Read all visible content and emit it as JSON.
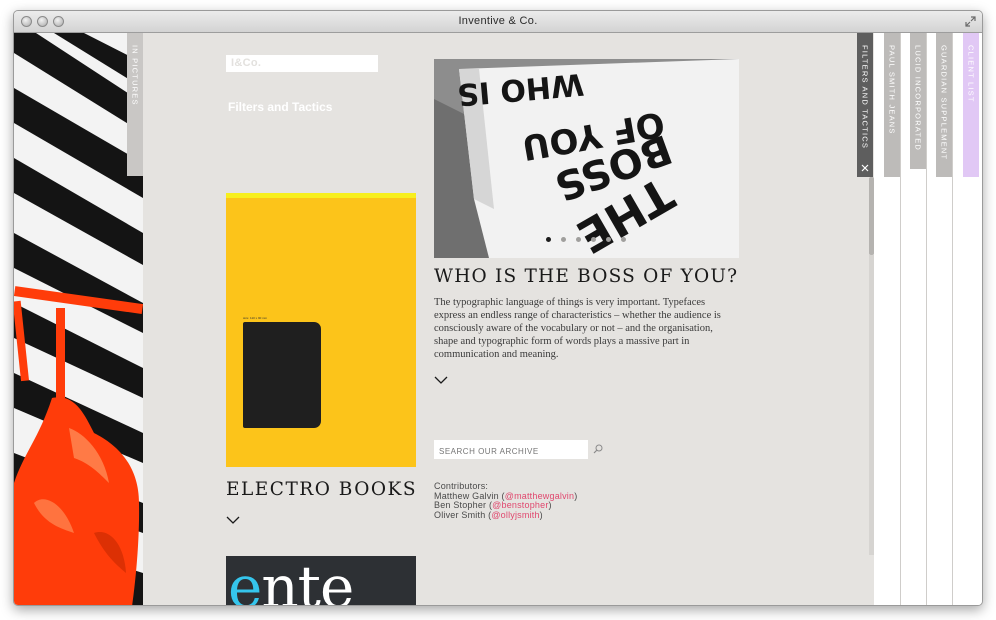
{
  "window": {
    "title": "Inventive & Co."
  },
  "left_tab": {
    "label": "IN PICTURES"
  },
  "header": {
    "logo": "I&Co.",
    "section": "Filters and Tactics"
  },
  "book": {
    "label": "size: 110 x 90 mm",
    "title": "ELECTRO BOOKS"
  },
  "teaser": {
    "text_a": "e",
    "text_b": "nte"
  },
  "feature": {
    "image_text": [
      "THE",
      "BOSS",
      "OF YOU",
      "WHO IS"
    ],
    "slides": 6,
    "active_slide": 1,
    "title": "WHO IS THE BOSS OF YOU?",
    "body": "The typographic language of things is very important. Typefaces express an endless range of characteristics – whether the audience is consciously aware of the vocabulary or not – and the organisation, shape and typographic form of words plays a massive part in communication and meaning."
  },
  "search": {
    "placeholder": "SEARCH OUR ARCHIVE"
  },
  "contributors": {
    "heading": "Contributors:",
    "people": [
      {
        "name": "Matthew Galvin",
        "handle": "@matthewgalvin"
      },
      {
        "name": "Ben Stopher",
        "handle": "@benstopher"
      },
      {
        "name": "Oliver Smith",
        "handle": "@ollyjsmith"
      }
    ]
  },
  "right_tabs": [
    {
      "label": "FILTERS AND TACTICS",
      "color": "#5e5e5e",
      "active": true
    },
    {
      "label": "PAUL SMITH JEANS",
      "color": "#bdbbb9"
    },
    {
      "label": "LUCID INCORPORATED",
      "color": "#bdbbb9"
    },
    {
      "label": "GUARDIAN SUPPLEMENT",
      "color": "#bdbbb9"
    },
    {
      "label": "CLIENT LIST",
      "color": "#e1c8f5"
    }
  ],
  "colors": {
    "accent_pink": "#e0486e",
    "book_yellow": "#fcc41a",
    "orange": "#ff3c0a"
  }
}
